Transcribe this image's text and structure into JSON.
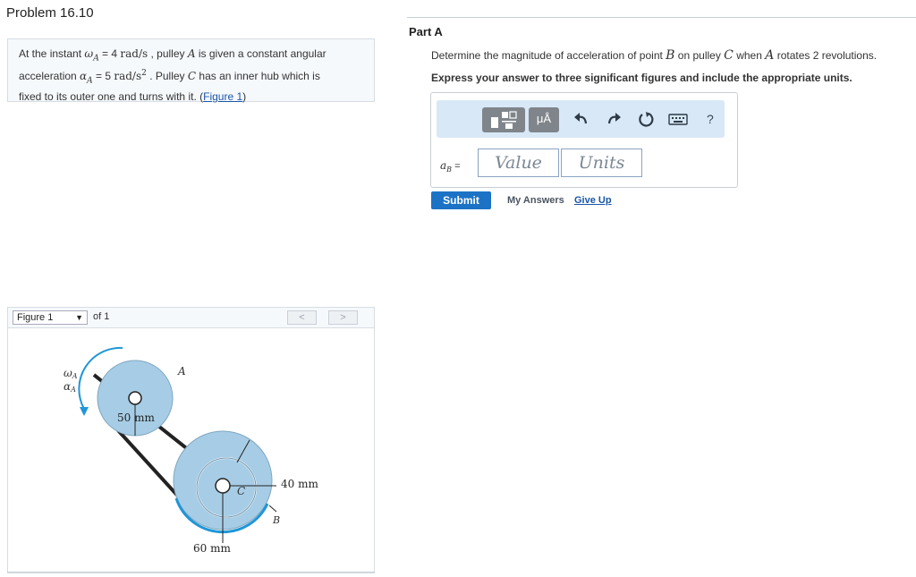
{
  "problem": {
    "title": "Problem 16.10",
    "statement": {
      "p1": "At the instant ",
      "omega_sym": "ω",
      "sub_a": "A",
      "eq1": " = 4 ",
      "unit1": "rad/s",
      "p2": " , pulley ",
      "pulley_a": "A",
      "p3": " is given a constant angular",
      "p4": "acceleration ",
      "alpha_sym": "α",
      "eq2": " = 5 ",
      "unit2": "rad/s",
      "sup2": "2",
      "p5": " . Pulley ",
      "pulley_c": "C",
      "p6": " has an inner hub which is",
      "p7": "fixed to its outer one and turns with it. (",
      "figure_link": "Figure 1",
      "p8": ")"
    }
  },
  "figure_nav": {
    "selected": "Figure 1",
    "of_text": "of 1",
    "prev": "<",
    "next": ">"
  },
  "figure": {
    "omega_label": "ω",
    "alpha_label": "α",
    "sub_a": "A",
    "label_a": "A",
    "label_c": "C",
    "label_b": "B",
    "dim_50": "50 mm",
    "dim_40": "40 mm",
    "dim_60": "60 mm",
    "colors": {
      "pulley_fill": "#a7cde6",
      "accent_blue": "#1f96d8"
    }
  },
  "part": {
    "label": "Part A",
    "question": {
      "q1": "Determine the magnitude of acceleration of point ",
      "point_b": "B",
      "q2": " on pulley ",
      "pulley_c": "C",
      "q3": " when ",
      "pulley_a": "A",
      "q4": " rotates 2 revolutions."
    },
    "instruction": "Express your answer to three significant figures and include the appropriate units."
  },
  "answer": {
    "toolbar": {
      "units_btn": "μÅ",
      "help": "?"
    },
    "label_a": "a",
    "label_sub": "B",
    "label_eq": " =",
    "value_placeholder": "Value",
    "units_placeholder": "Units"
  },
  "actions": {
    "submit": "Submit",
    "my_answers": "My Answers",
    "give_up": "Give Up"
  }
}
